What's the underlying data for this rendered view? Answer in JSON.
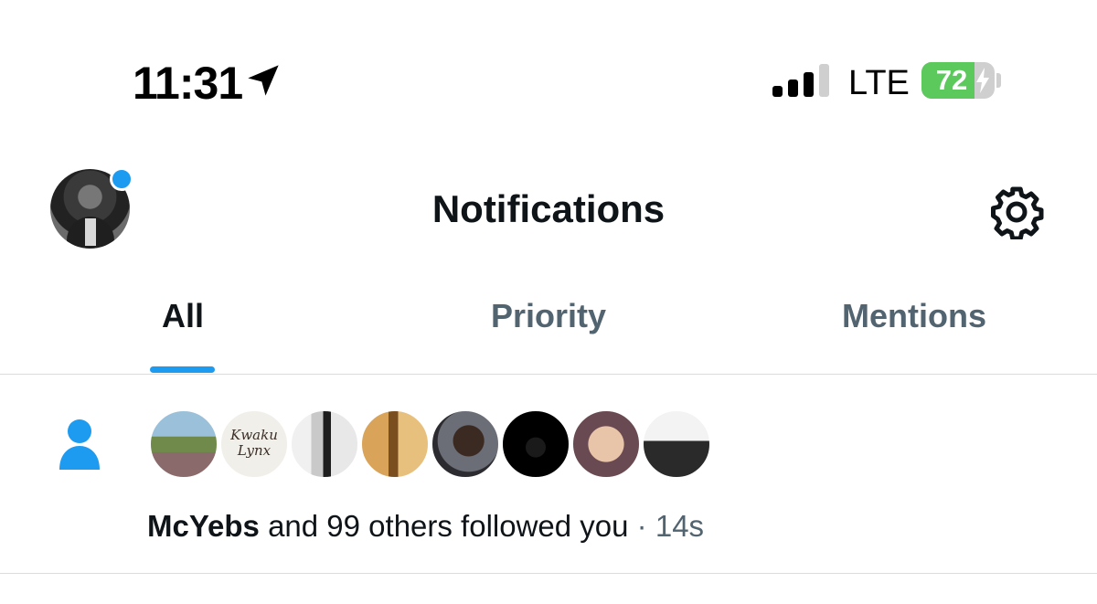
{
  "status_bar": {
    "time": "11:31",
    "network": "LTE",
    "battery_level": "72",
    "battery_fraction": 0.72,
    "signal_bars_active": 3,
    "signal_bars_total": 4
  },
  "header": {
    "title": "Notifications",
    "unread_dot_color": "#1d9bf0"
  },
  "tabs": [
    {
      "label": "All",
      "active": true
    },
    {
      "label": "Priority",
      "active": false
    },
    {
      "label": "Mentions",
      "active": false
    }
  ],
  "notification": {
    "icon": "person-icon",
    "actor": "McYebs",
    "text": " and 99 others followed you",
    "separator": " · ",
    "time": "14s",
    "follower_avatars": [
      {
        "label": ""
      },
      {
        "label": "Kwaku Lynx"
      },
      {
        "label": ""
      },
      {
        "label": ""
      },
      {
        "label": ""
      },
      {
        "label": ""
      },
      {
        "label": ""
      },
      {
        "label": ""
      }
    ]
  },
  "colors": {
    "accent": "#1d9bf0",
    "primary_text": "#0f1419",
    "secondary_text": "#536471",
    "battery_green": "#5bc95b"
  }
}
